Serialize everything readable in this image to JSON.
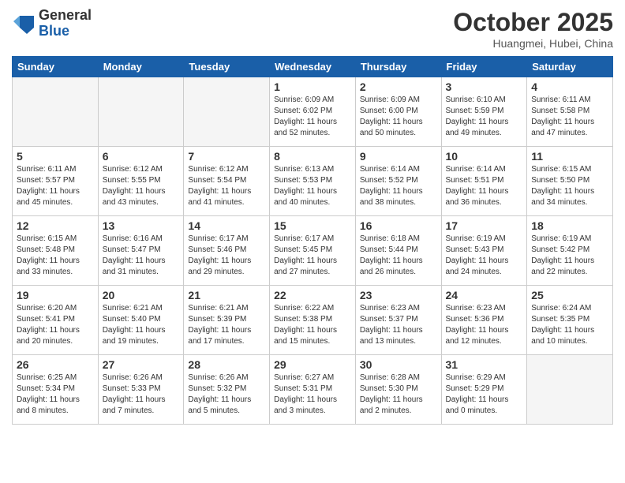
{
  "logo": {
    "general": "General",
    "blue": "Blue"
  },
  "title": "October 2025",
  "location": "Huangmei, Hubei, China",
  "days_of_week": [
    "Sunday",
    "Monday",
    "Tuesday",
    "Wednesday",
    "Thursday",
    "Friday",
    "Saturday"
  ],
  "weeks": [
    [
      {
        "day": "",
        "info": ""
      },
      {
        "day": "",
        "info": ""
      },
      {
        "day": "",
        "info": ""
      },
      {
        "day": "1",
        "info": "Sunrise: 6:09 AM\nSunset: 6:02 PM\nDaylight: 11 hours\nand 52 minutes."
      },
      {
        "day": "2",
        "info": "Sunrise: 6:09 AM\nSunset: 6:00 PM\nDaylight: 11 hours\nand 50 minutes."
      },
      {
        "day": "3",
        "info": "Sunrise: 6:10 AM\nSunset: 5:59 PM\nDaylight: 11 hours\nand 49 minutes."
      },
      {
        "day": "4",
        "info": "Sunrise: 6:11 AM\nSunset: 5:58 PM\nDaylight: 11 hours\nand 47 minutes."
      }
    ],
    [
      {
        "day": "5",
        "info": "Sunrise: 6:11 AM\nSunset: 5:57 PM\nDaylight: 11 hours\nand 45 minutes."
      },
      {
        "day": "6",
        "info": "Sunrise: 6:12 AM\nSunset: 5:55 PM\nDaylight: 11 hours\nand 43 minutes."
      },
      {
        "day": "7",
        "info": "Sunrise: 6:12 AM\nSunset: 5:54 PM\nDaylight: 11 hours\nand 41 minutes."
      },
      {
        "day": "8",
        "info": "Sunrise: 6:13 AM\nSunset: 5:53 PM\nDaylight: 11 hours\nand 40 minutes."
      },
      {
        "day": "9",
        "info": "Sunrise: 6:14 AM\nSunset: 5:52 PM\nDaylight: 11 hours\nand 38 minutes."
      },
      {
        "day": "10",
        "info": "Sunrise: 6:14 AM\nSunset: 5:51 PM\nDaylight: 11 hours\nand 36 minutes."
      },
      {
        "day": "11",
        "info": "Sunrise: 6:15 AM\nSunset: 5:50 PM\nDaylight: 11 hours\nand 34 minutes."
      }
    ],
    [
      {
        "day": "12",
        "info": "Sunrise: 6:15 AM\nSunset: 5:48 PM\nDaylight: 11 hours\nand 33 minutes."
      },
      {
        "day": "13",
        "info": "Sunrise: 6:16 AM\nSunset: 5:47 PM\nDaylight: 11 hours\nand 31 minutes."
      },
      {
        "day": "14",
        "info": "Sunrise: 6:17 AM\nSunset: 5:46 PM\nDaylight: 11 hours\nand 29 minutes."
      },
      {
        "day": "15",
        "info": "Sunrise: 6:17 AM\nSunset: 5:45 PM\nDaylight: 11 hours\nand 27 minutes."
      },
      {
        "day": "16",
        "info": "Sunrise: 6:18 AM\nSunset: 5:44 PM\nDaylight: 11 hours\nand 26 minutes."
      },
      {
        "day": "17",
        "info": "Sunrise: 6:19 AM\nSunset: 5:43 PM\nDaylight: 11 hours\nand 24 minutes."
      },
      {
        "day": "18",
        "info": "Sunrise: 6:19 AM\nSunset: 5:42 PM\nDaylight: 11 hours\nand 22 minutes."
      }
    ],
    [
      {
        "day": "19",
        "info": "Sunrise: 6:20 AM\nSunset: 5:41 PM\nDaylight: 11 hours\nand 20 minutes."
      },
      {
        "day": "20",
        "info": "Sunrise: 6:21 AM\nSunset: 5:40 PM\nDaylight: 11 hours\nand 19 minutes."
      },
      {
        "day": "21",
        "info": "Sunrise: 6:21 AM\nSunset: 5:39 PM\nDaylight: 11 hours\nand 17 minutes."
      },
      {
        "day": "22",
        "info": "Sunrise: 6:22 AM\nSunset: 5:38 PM\nDaylight: 11 hours\nand 15 minutes."
      },
      {
        "day": "23",
        "info": "Sunrise: 6:23 AM\nSunset: 5:37 PM\nDaylight: 11 hours\nand 13 minutes."
      },
      {
        "day": "24",
        "info": "Sunrise: 6:23 AM\nSunset: 5:36 PM\nDaylight: 11 hours\nand 12 minutes."
      },
      {
        "day": "25",
        "info": "Sunrise: 6:24 AM\nSunset: 5:35 PM\nDaylight: 11 hours\nand 10 minutes."
      }
    ],
    [
      {
        "day": "26",
        "info": "Sunrise: 6:25 AM\nSunset: 5:34 PM\nDaylight: 11 hours\nand 8 minutes."
      },
      {
        "day": "27",
        "info": "Sunrise: 6:26 AM\nSunset: 5:33 PM\nDaylight: 11 hours\nand 7 minutes."
      },
      {
        "day": "28",
        "info": "Sunrise: 6:26 AM\nSunset: 5:32 PM\nDaylight: 11 hours\nand 5 minutes."
      },
      {
        "day": "29",
        "info": "Sunrise: 6:27 AM\nSunset: 5:31 PM\nDaylight: 11 hours\nand 3 minutes."
      },
      {
        "day": "30",
        "info": "Sunrise: 6:28 AM\nSunset: 5:30 PM\nDaylight: 11 hours\nand 2 minutes."
      },
      {
        "day": "31",
        "info": "Sunrise: 6:29 AM\nSunset: 5:29 PM\nDaylight: 11 hours\nand 0 minutes."
      },
      {
        "day": "",
        "info": ""
      }
    ]
  ]
}
